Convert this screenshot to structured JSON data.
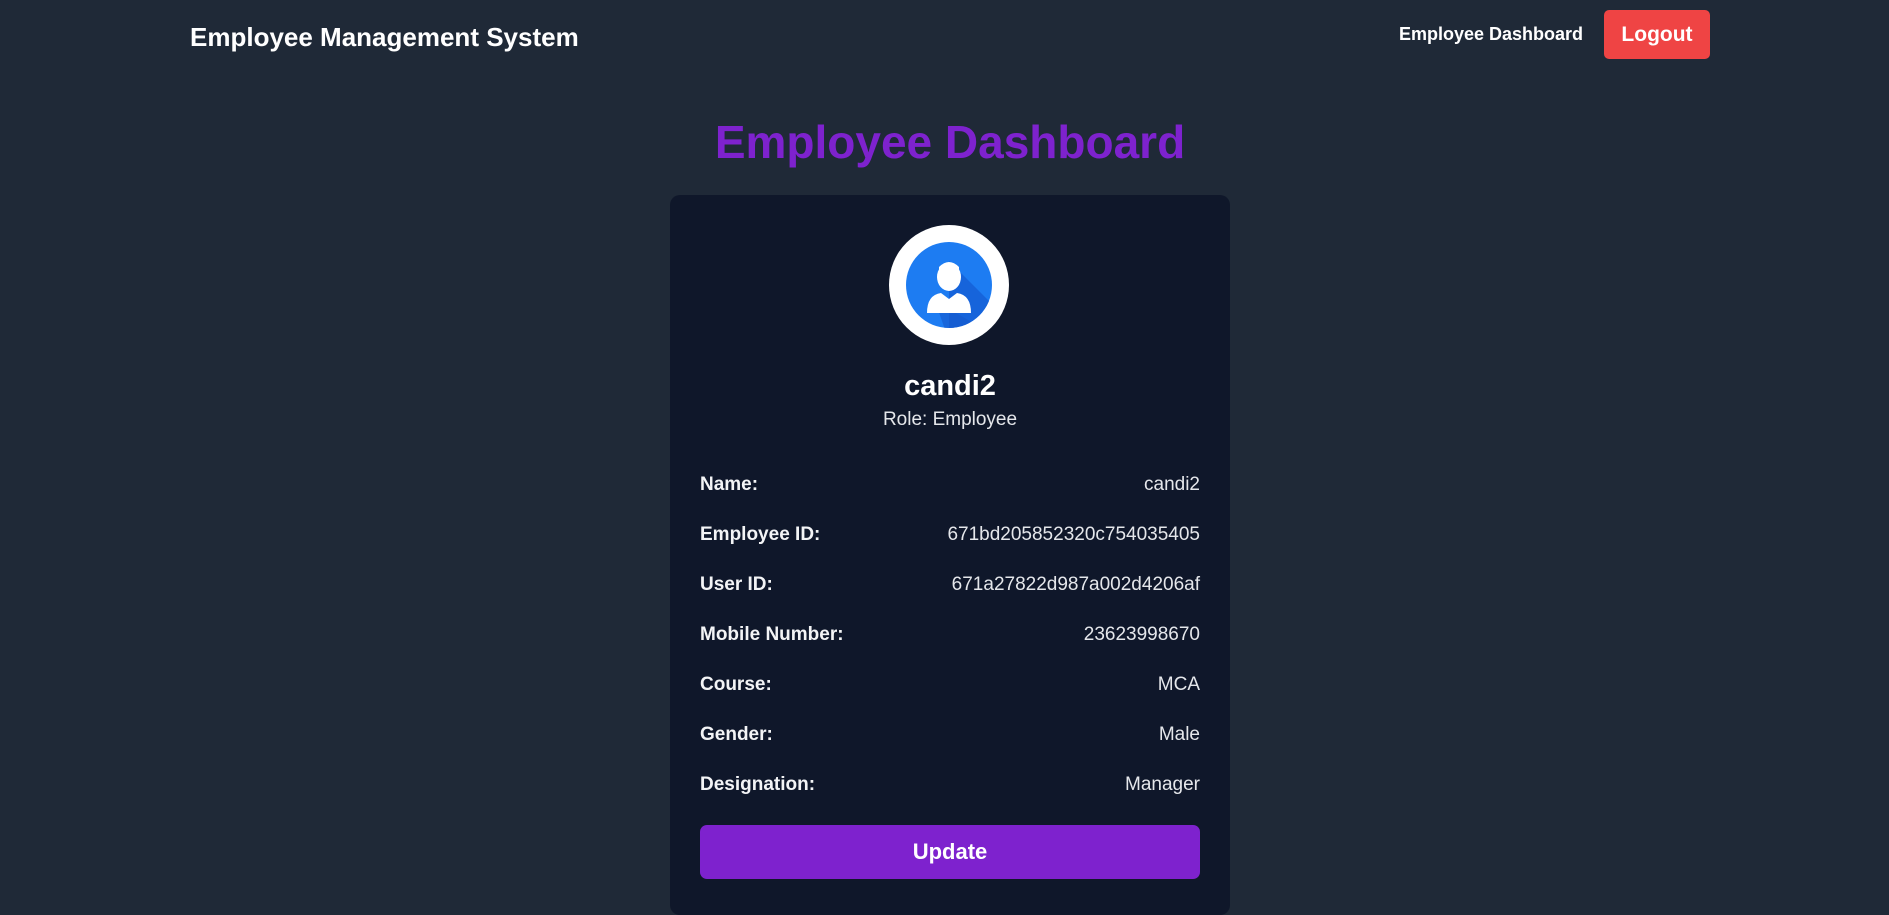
{
  "navbar": {
    "brand": "Employee Management System",
    "dashboard_link": "Employee Dashboard",
    "logout_label": "Logout"
  },
  "page": {
    "title": "Employee Dashboard"
  },
  "profile": {
    "avatar_icon": "user-avatar-icon",
    "username": "candi2",
    "role_text": "Role: Employee"
  },
  "details": {
    "rows": [
      {
        "label": "Name:",
        "value": "candi2"
      },
      {
        "label": "Employee ID:",
        "value": "671bd205852320c754035405"
      },
      {
        "label": "User ID:",
        "value": "671a27822d987a002d4206af"
      },
      {
        "label": "Mobile Number:",
        "value": "23623998670"
      },
      {
        "label": "Course:",
        "value": "MCA"
      },
      {
        "label": "Gender:",
        "value": "Male"
      },
      {
        "label": "Designation:",
        "value": "Manager"
      }
    ]
  },
  "actions": {
    "update_label": "Update"
  },
  "colors": {
    "background": "#1f2937",
    "card": "#0f172a",
    "accent_purple": "#7e22ce",
    "logout_red": "#ef4444",
    "avatar_blue": "#1d6fe6"
  }
}
